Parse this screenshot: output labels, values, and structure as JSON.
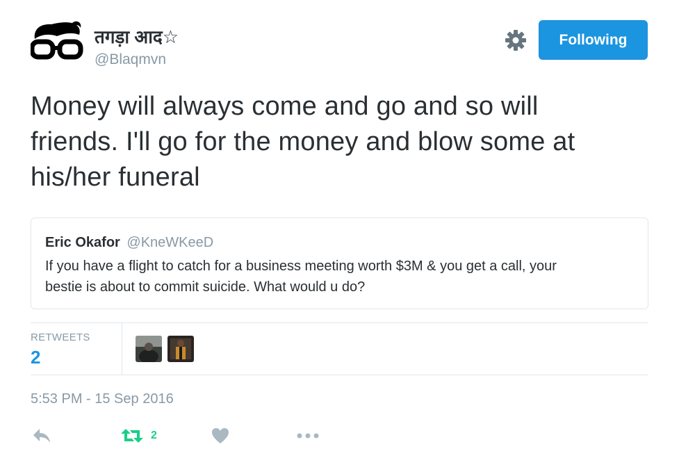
{
  "user": {
    "display_name": "तगड़ा आद☆",
    "handle": "@Blaqmvn",
    "avatar_icon": "glasses-hair-avatar-icon"
  },
  "header": {
    "settings_icon": "gear-icon",
    "follow_label": "Following",
    "follow_color": "#1b95e0"
  },
  "tweet": {
    "lines": [
      "Money will always come and go and so will",
      "friends. I'll go for the money and blow some at",
      "his/her funeral"
    ]
  },
  "quote": {
    "name": "Eric Okafor",
    "handle": "@KneWKeeD",
    "lines": [
      "If you have a flight to catch for a business meeting worth $3M &  you get a call, your",
      "bestie is about to commit suicide.  What would u do?"
    ]
  },
  "stats": {
    "retweets_label": "RETWEETS",
    "retweets_count": "2"
  },
  "timestamp": "5:53 PM - 15 Sep 2016",
  "actions": {
    "reply_icon": "reply-icon",
    "retweet_icon": "retweet-icon",
    "retweet_count": "2",
    "like_icon": "heart-icon",
    "more_icon": "more-dots-icon",
    "retweet_color": "#19cf86",
    "icon_color": "#aab8c2"
  }
}
